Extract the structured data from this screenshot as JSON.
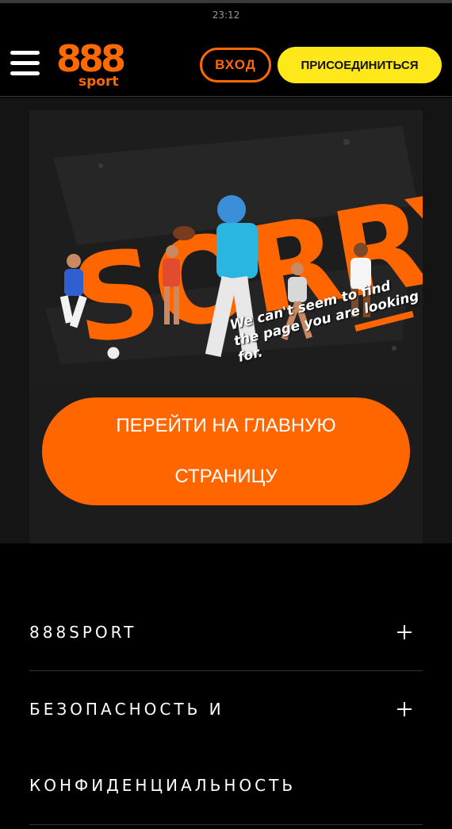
{
  "status_bar": {
    "time": "23:12"
  },
  "header": {
    "logo_main": "888",
    "logo_sub": "sport",
    "login_label": "ВХОД",
    "join_label": "ПРИСОЕДИНИТЬСЯ",
    "icons": [
      "menu-icon"
    ]
  },
  "banner": {
    "headline": "SORRY!",
    "tagline": "We can't seem to find the page you are looking for."
  },
  "main": {
    "home_button_label": "ПЕРЕЙТИ НА ГЛАВНУЮ СТРАНИЦУ"
  },
  "footer": {
    "items": [
      {
        "label": "888SPORT"
      },
      {
        "label": "БЕЗОПАСНОСТЬ И КОНФИДЕНЦИАЛЬНОСТЬ"
      }
    ]
  },
  "colors": {
    "brand_orange": "#ff6600",
    "join_yellow": "#ffe81a",
    "background": "#000000",
    "card_bg": "#1c1c1c"
  }
}
